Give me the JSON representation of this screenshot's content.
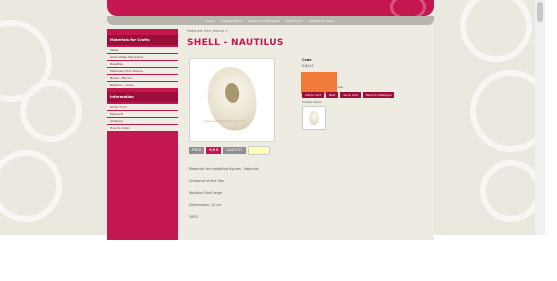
{
  "header": {
    "nav_links": [
      "Home",
      "Private Sector",
      "Special Consolidated",
      "Order Form",
      "Identity Numbers"
    ]
  },
  "breadcrumb": "Materials from Nature >",
  "product": {
    "title": "SHELL - NAUTILUS",
    "image_watermark": "www.shellinternational.com",
    "price_label": "PRICE",
    "price_value": "9.9 €",
    "quantity_label": "QUANTITY",
    "quantity_value": "",
    "code_label": "Code",
    "code_value": "K-NA23",
    "category_suffix": "alis",
    "buttons": [
      "Add to Cart",
      "Next",
      "Go to Cart",
      "Back to Catalogue"
    ],
    "also_label": "Similar Items",
    "description": [
      "Materials for modelling figures - Naturals",
      "Creatures of the Sea",
      "Nautilus Shell large",
      "Dimensions: 12 cm",
      "2003"
    ]
  },
  "sidebar": {
    "materials_header": "Materials for Crafts",
    "materials_items": [
      "Metal",
      "Glass Paste Marquetry",
      "Rosettes",
      "Materials from Nature",
      "Boxes - Mirrors",
      "Ribbons - Laces"
    ],
    "info_header": "Information",
    "info_items": [
      "Order Form",
      "Payment",
      "Shipping",
      "How to Order"
    ]
  },
  "colors": {
    "brand": "#c4174f",
    "brand_dark": "#9d0f3a",
    "highlight": "#f07c3c",
    "page_bg": "#eeece2"
  }
}
